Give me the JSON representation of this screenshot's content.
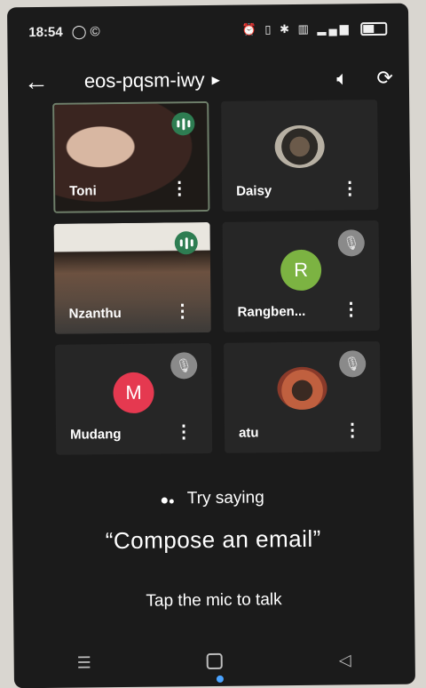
{
  "status": {
    "time": "18:54"
  },
  "appbar": {
    "meeting_code": "eos-pqsm-iwy"
  },
  "participants": [
    {
      "name": "Toni",
      "type": "video"
    },
    {
      "name": "Daisy",
      "type": "photo"
    },
    {
      "name": "Nzanthu",
      "type": "video"
    },
    {
      "name": "Rangben...",
      "type": "initial",
      "initial": "R",
      "color": "#7cb342"
    },
    {
      "name": "Mudang",
      "type": "initial",
      "initial": "M",
      "color": "#e53950"
    },
    {
      "name": "atu",
      "type": "photo"
    }
  ],
  "assistant": {
    "try_label": "Try saying",
    "suggestion": "“Compose an email”",
    "hint": "Tap the mic to talk"
  },
  "colors": {
    "speaking": "#2e7d52",
    "muted": "#8a8a8a",
    "accent": "#4aa3ff"
  },
  "icons": [
    "back-arrow-icon",
    "speaker-icon",
    "switch-camera-icon",
    "more-vert-icon",
    "mic-off-icon",
    "audio-level-icon",
    "assistant-dots-icon"
  ]
}
